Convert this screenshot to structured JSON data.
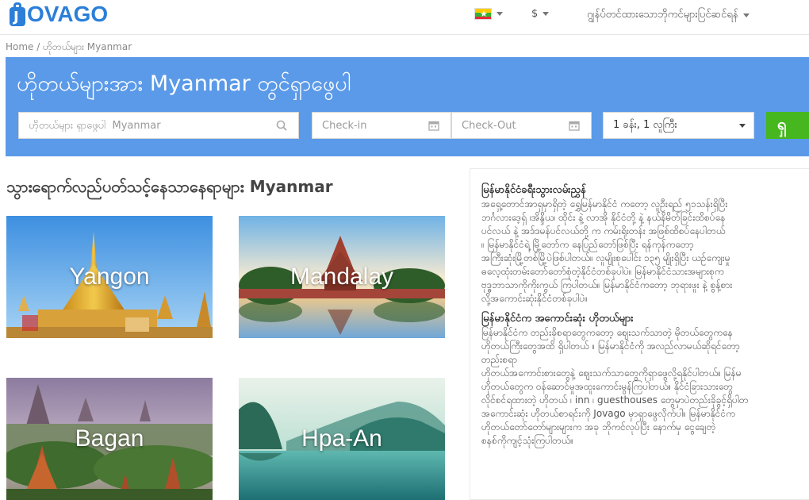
{
  "header": {
    "logo_text": "OVAGO",
    "logo_letter": "J",
    "currency": "$",
    "bookings_label": "ဂျွန်ပ်တင်ထားသောဘိုကင်များပြင်ဆင်ရန်"
  },
  "breadcrumb": {
    "home": "Home",
    "separator": "/",
    "current": "ဟိုတယ်များ Myanmar"
  },
  "search": {
    "title": "ဟိုတယ်များအား Myanmar တွင်ရှာဖွေပါ",
    "destination_placeholder": "ဟိုတယ်များ ရှာဖွေပါ  Myanmar",
    "checkin_placeholder": "Check-in",
    "checkout_placeholder": "Check-Out",
    "guests_value": "1 ခန်း, 1 လူကြီး",
    "button_label": "ရှ"
  },
  "destinations": {
    "title": "သွားရောက်လည်ပတ်သင့်နေသာနေရာများ Myanmar",
    "tiles": [
      {
        "name": "Yangon"
      },
      {
        "name": "Mandalay"
      },
      {
        "name": "Bagan"
      },
      {
        "name": "Hpa-An"
      }
    ]
  },
  "info": {
    "heading1": "မြန်မာနိုင်ငံခရီးသွားလမ်းညွှန်",
    "para1": [
      "အရှေ့တောင်အာရှမှာရှိတဲ့ ရွှေမြန်မာနိုင်ငံ ကတော့ လူဦးရည် ၅၁သန်းရှိပြီး",
      "ဘင်္ဂလားဒေ့ရှ် ၊အိန္ဒိယ၊ ထိုင်း နဲ့ လာအို နိုင်ငံတို့ နဲ့ နယ်နိမိတ်ခြင်းထိစပ်နေ",
      "ပင်လယ် နဲ့ အဒ်ဒမန်ပင်လယ်တို့ က ကမ်းရိုးတန်း အဖြစ်ထိစပ်နေပါတယ်",
      "။ မြန်မာနိုင်ငံရဲ့ မြို့တော်က နေပြည်တော်ဖြစ်ပြီး ရန်ကုန်ကတော့",
      "အကြီးဆုံးမြို့တစ်မြို့ပဲဖြစ်ပါတယ်။ လူမျိုးစုပေါင်း ၁၃၅ မျိုးရှိပြီး ယဉ်ကျေးမှု",
      "ဓလေ့ထုံးတမ်းတော်တော်စုံတဲ့နိုင်ငံတစ်ခုပါပဲ။ မြန်မာနိုင်ငံသားအများစုက",
      "ဗုဒ္ဓဘာသာကိုကိုးကွယ် ကြပါတယ်။ မြန်မာနိုင်ငံကတော့ ဘုရားဖူး နဲ့ စွန့်စား",
      "လို့အကောင်းဆုံးနိုင်ငံတစ်ခုပါပဲ။"
    ],
    "heading2": "မြန်မာနိုင်ငံက အကောင်းဆုံး ဟိုတယ်များ",
    "para2": [
      "မြန်မာနိုင်ငံက တည်းခိုစရာတွေကတော့ ဈေးသက်သာတဲ့ မိုတယ်တွေကနေ",
      "ဟိုတယ်ကြီးတွေအထိ ရှိပါတယ် ။ မြန်မာနိုင်ငံကို အလည်လာမယ်ဆိုရင်တော့",
      "တည်းစရာ",
      "ဟိုတယ်အကောင်းစားတွေနဲ့ ဈေးသက်သာတွေကိုရှာဖွေလို့ရနိုင်ပါတယ်။ မြန်မ",
      "ဟိုတယ်တွေက ဝန်ဆောင်မှုအထူးကောင်းမွန်ကြပါတယ်။ နိုင်ငံခြားသားတွေ",
      "လိုင်စင်ရထားတဲ့ ဟိုတယ် ၊ inn ၊ guesthouses တွေမှာပဲတည်းခိုခွင့်ရှိပါတ",
      "အကောင်းဆုံး ဟိုတယ်စာရင်းကို Jovago မှာရှာဖွေလိုက်ပါ။ မြန်မာနိုင်ငံက",
      "ဟိုတယ်တော်တော်များများက အခု ဘိုကင်လုပ်ပြီး နောက်မှ ငွေချေတဲ့",
      "စနစ်ကိုကျင့်သုံးကြပါတယ်။"
    ]
  },
  "colors": {
    "brand": "#2b7fd9",
    "search_band": "#5b9ae8",
    "search_button": "#47b71f"
  }
}
